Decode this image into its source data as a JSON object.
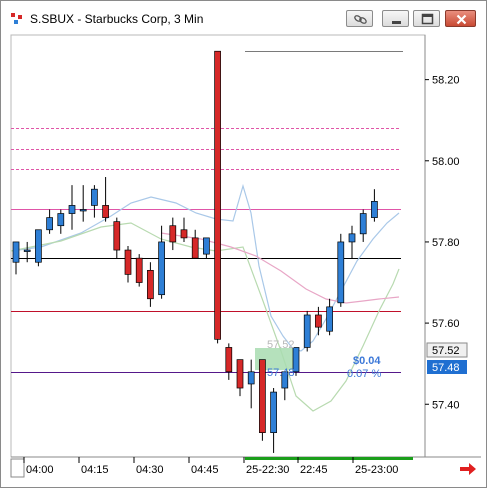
{
  "window": {
    "title": "S.SBUX - Starbucks Corp, 3 Min"
  },
  "icons": {
    "app": "chart-app-icon",
    "link": "link-chain-icon",
    "minimize": "minimize-icon",
    "maximize": "maximize-icon",
    "close": "close-icon",
    "scroll": "scroll-right-arrow-icon"
  },
  "colors": {
    "up_candle": "#2e7fd6",
    "down_candle": "#d62828",
    "position_box": "#a8dcb0",
    "profit_text": "#3c78d8",
    "current_price_bg": "#1f6fd1",
    "accent_arrow": "#e02020"
  },
  "price_axis": {
    "ticks": [
      "58.20",
      "58.00",
      "57.80",
      "57.60",
      "57.40"
    ],
    "last_price": "57.52",
    "current_price": "57.48"
  },
  "time_axis": {
    "ticks": [
      "04:00",
      "04:15",
      "04:30",
      "04:45",
      "25-22:30",
      "22:45",
      "25-23:00"
    ]
  },
  "position": {
    "entry_label": "57.52",
    "pl_label": "$0.04",
    "pct_label": "0.07 %",
    "short_label": "57.48"
  },
  "chart_data": {
    "type": "candlestick",
    "title": "S.SBUX - Starbucks Corp, 3 Min",
    "ylim": [
      57.27,
      58.31
    ],
    "y_ticks": [
      58.2,
      58.0,
      57.8,
      57.6,
      57.4
    ],
    "x_ticks": [
      "04:00",
      "04:15",
      "04:30",
      "04:45",
      "25-22:30",
      "22:45",
      "25-23:00"
    ],
    "candles": [
      {
        "o": 57.75,
        "h": 57.77,
        "l": 57.72,
        "c": 57.8
      },
      {
        "o": 57.78,
        "h": 57.8,
        "l": 57.75,
        "c": 57.78
      },
      {
        "o": 57.75,
        "h": 57.83,
        "l": 57.74,
        "c": 57.83
      },
      {
        "o": 57.83,
        "h": 57.88,
        "l": 57.82,
        "c": 57.86
      },
      {
        "o": 57.84,
        "h": 57.88,
        "l": 57.82,
        "c": 57.87
      },
      {
        "o": 57.87,
        "h": 57.94,
        "l": 57.83,
        "c": 57.89
      },
      {
        "o": 57.88,
        "h": 57.94,
        "l": 57.85,
        "c": 57.88
      },
      {
        "o": 57.89,
        "h": 57.94,
        "l": 57.86,
        "c": 57.93
      },
      {
        "o": 57.89,
        "h": 57.96,
        "l": 57.85,
        "c": 57.86
      },
      {
        "o": 57.85,
        "h": 57.86,
        "l": 57.76,
        "c": 57.78
      },
      {
        "o": 57.78,
        "h": 57.79,
        "l": 57.7,
        "c": 57.72
      },
      {
        "o": 57.76,
        "h": 57.77,
        "l": 57.69,
        "c": 57.7
      },
      {
        "o": 57.73,
        "h": 57.75,
        "l": 57.64,
        "c": 57.66
      },
      {
        "o": 57.67,
        "h": 57.84,
        "l": 57.66,
        "c": 57.8
      },
      {
        "o": 57.84,
        "h": 57.86,
        "l": 57.78,
        "c": 57.8
      },
      {
        "o": 57.83,
        "h": 57.86,
        "l": 57.8,
        "c": 57.81
      },
      {
        "o": 57.81,
        "h": 57.83,
        "l": 57.77,
        "c": 57.76
      },
      {
        "o": 57.77,
        "h": 57.81,
        "l": 57.76,
        "c": 57.81
      },
      {
        "o": 58.27,
        "h": 58.27,
        "l": 57.55,
        "c": 57.56
      },
      {
        "o": 57.54,
        "h": 57.55,
        "l": 57.46,
        "c": 57.48
      },
      {
        "o": 57.51,
        "h": 57.51,
        "l": 57.42,
        "c": 57.44
      },
      {
        "o": 57.45,
        "h": 57.51,
        "l": 57.39,
        "c": 57.48
      },
      {
        "o": 57.51,
        "h": 57.51,
        "l": 57.31,
        "c": 57.33
      },
      {
        "o": 57.33,
        "h": 57.44,
        "l": 57.28,
        "c": 57.43
      },
      {
        "o": 57.44,
        "h": 57.48,
        "l": 57.41,
        "c": 57.48
      },
      {
        "o": 57.48,
        "h": 57.54,
        "l": 57.47,
        "c": 57.54
      },
      {
        "o": 57.54,
        "h": 57.63,
        "l": 57.53,
        "c": 57.62
      },
      {
        "o": 57.62,
        "h": 57.64,
        "l": 57.57,
        "c": 57.59
      },
      {
        "o": 57.58,
        "h": 57.66,
        "l": 57.57,
        "c": 57.64
      },
      {
        "o": 57.65,
        "h": 57.82,
        "l": 57.64,
        "c": 57.8
      },
      {
        "o": 57.8,
        "h": 57.84,
        "l": 57.76,
        "c": 57.82
      },
      {
        "o": 57.82,
        "h": 57.88,
        "l": 57.8,
        "c": 57.87
      },
      {
        "o": 57.86,
        "h": 57.93,
        "l": 57.85,
        "c": 57.9
      }
    ],
    "reference_lines": [
      {
        "value": 58.27,
        "color": "#7a7a7a",
        "style": "solid"
      },
      {
        "value": 58.08,
        "color": "#e055a8",
        "style": "dashed"
      },
      {
        "value": 58.03,
        "color": "#e055a8",
        "style": "dashed"
      },
      {
        "value": 57.98,
        "color": "#e055a8",
        "style": "dashed"
      },
      {
        "value": 57.88,
        "color": "#e055a8",
        "style": "solid"
      },
      {
        "value": 57.76,
        "color": "#000000",
        "style": "solid"
      },
      {
        "value": 57.63,
        "color": "#c0102a",
        "style": "solid"
      },
      {
        "value": 57.48,
        "color": "#55188a",
        "style": "solid"
      }
    ]
  }
}
